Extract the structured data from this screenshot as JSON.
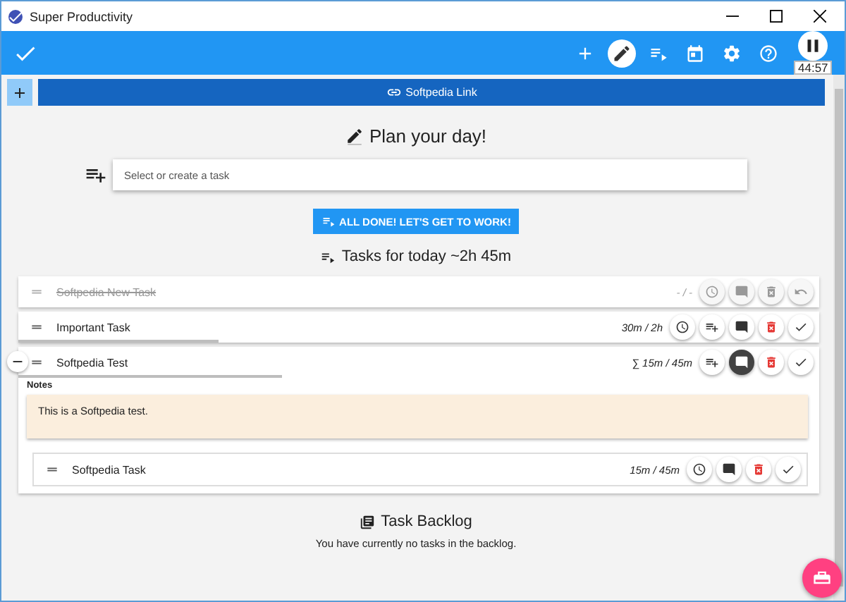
{
  "window": {
    "title": "Super Productivity"
  },
  "toolbar": [
    {
      "kind": "add",
      "selected": false
    },
    {
      "kind": "edit",
      "selected": true
    },
    {
      "kind": "queue",
      "selected": false
    },
    {
      "kind": "calendar",
      "selected": false
    },
    {
      "kind": "settings",
      "selected": false
    },
    {
      "kind": "help",
      "selected": false
    }
  ],
  "timer": {
    "time": "44:57"
  },
  "pinned_link": {
    "label": "Softpedia Link"
  },
  "plan": {
    "title": "Plan your day!",
    "placeholder": "Select or create a task",
    "button": "ALL DONE! LET'S GET TO WORK!",
    "tasks_heading": "Tasks for today ~2h 45m"
  },
  "tasks": [
    {
      "title": "Softpedia New Task",
      "done": true,
      "time": "- / -",
      "actions": [
        {
          "kind": "clock"
        },
        {
          "kind": "notes",
          "selected": false
        },
        {
          "kind": "delete"
        },
        {
          "kind": "undo"
        }
      ]
    },
    {
      "title": "Important Task",
      "done": false,
      "time": "30m / 2h",
      "level": 0.25,
      "actions": [
        {
          "kind": "clock"
        },
        {
          "kind": "add-subtask"
        },
        {
          "kind": "notes",
          "selected": false
        },
        {
          "kind": "delete"
        },
        {
          "kind": "done"
        }
      ]
    },
    {
      "title": "Softpedia Test",
      "done": false,
      "time": "∑ 15m / 45m",
      "level": 0.33,
      "expanded": true,
      "actions": [
        {
          "kind": "add-subtask"
        },
        {
          "kind": "notes",
          "selected": true
        },
        {
          "kind": "delete"
        },
        {
          "kind": "done"
        }
      ],
      "notes": {
        "label": "Notes",
        "text": "This is a Softpedia test."
      },
      "children": [
        {
          "title": "Softpedia Task",
          "done": false,
          "time": "15m / 45m",
          "actions": [
            {
              "kind": "clock"
            },
            {
              "kind": "notes",
              "selected": false
            },
            {
              "kind": "delete"
            },
            {
              "kind": "done"
            }
          ]
        }
      ]
    }
  ],
  "backlog": {
    "title": "Task Backlog",
    "empty_text": "You have currently no tasks in the backlog."
  }
}
